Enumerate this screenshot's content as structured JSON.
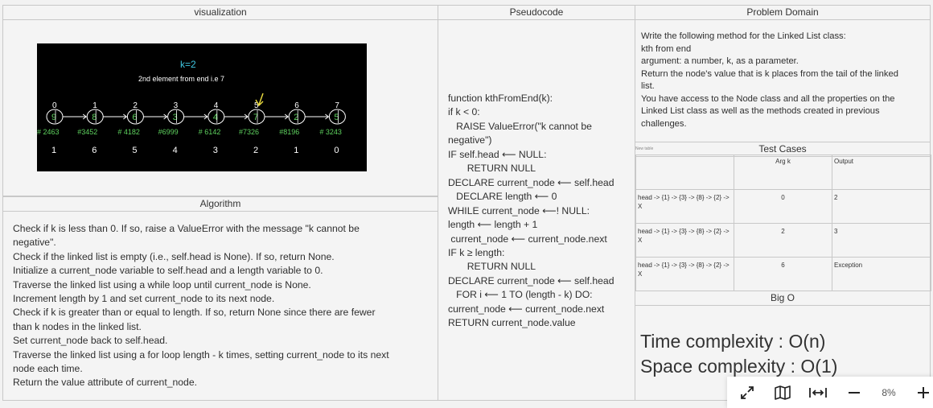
{
  "panels": {
    "visualization": {
      "title": "visualization"
    },
    "pseudocode": {
      "title": "Pseudocode",
      "lines": [
        "function kthFromEnd(k):",
        "if k < 0:",
        "   RAISE ValueError(\"k cannot be",
        "negative\")",
        "IF self.head ⟵ NULL:",
        "       RETURN NULL",
        "DECLARE current_node ⟵ self.head",
        "   DECLARE length ⟵ 0",
        "WHILE current_node ⟵! NULL:",
        "length ⟵ length + 1",
        " current_node ⟵ current_node.next",
        "IF k ≥ length:",
        "       RETURN NULL",
        "DECLARE current_node ⟵ self.head",
        "   FOR i ⟵ 1 TO (length - k) DO:",
        "current_node ⟵ current_node.next",
        "RETURN current_node.value"
      ]
    },
    "problem_domain": {
      "title": "Problem Domain",
      "lines": [
        "Write the following method for the Linked List class:",
        "kth from end",
        "argument: a number, k, as a parameter.",
        "Return the node's value that is k places from the tail of the linked",
        "list.",
        "You have access to the Node class and all the properties on the",
        "Linked List class as well as the methods created in previous",
        "challenges."
      ]
    },
    "algorithm": {
      "title": "Algorithm",
      "lines": [
        "Check if k is less than 0. If so, raise a ValueError with the message \"k cannot be",
        "negative\".",
        "Check if the linked list is empty (i.e., self.head is None). If so, return None.",
        "Initialize a current_node variable to self.head and a length variable to 0.",
        "Traverse the linked list using a while loop until current_node is None.",
        "Increment length by 1 and set current_node to its next node.",
        "Check if k is greater than or equal to length. If so, return None since there are fewer",
        "than k nodes in the linked list.",
        "Set current_node back to self.head.",
        "Traverse the linked list using a for loop length - k times, setting current_node to its next",
        "node each time.",
        "Return the value attribute of current_node."
      ]
    },
    "test_cases": {
      "title": "Test Cases",
      "table_label": "New table",
      "headers": [
        "",
        "Arg k",
        "Output"
      ],
      "rows": [
        [
          "head -> {1} -> {3} -> {8} -> {2} -> X",
          "0",
          "2"
        ],
        [
          "head -> {1} -> {3} -> {8} -> {2} -> X",
          "2",
          "3"
        ],
        [
          "head -> {1} -> {3} -> {8} -> {2} -> X",
          "6",
          "Exception"
        ]
      ]
    },
    "big_o": {
      "title": "Big O",
      "time": "Time complexity : O(n)",
      "space": "Space complexity : O(1)"
    }
  },
  "visualization_image": {
    "heading": "k=2",
    "subheading": "2nd element from end i.e 7",
    "nodes": [
      {
        "index": "0",
        "value": "9",
        "address": "# 2463",
        "from_end": "1"
      },
      {
        "index": "1",
        "value": "8",
        "address": "#3452",
        "from_end": "6"
      },
      {
        "index": "2",
        "value": "6",
        "address": "# 4182",
        "from_end": "5"
      },
      {
        "index": "3",
        "value": "3",
        "address": "#6999",
        "from_end": "4"
      },
      {
        "index": "4",
        "value": "4",
        "address": "# 6142",
        "from_end": "3"
      },
      {
        "index": "5",
        "value": "7",
        "address": "#7326",
        "from_end": "2"
      },
      {
        "index": "6",
        "value": "2",
        "address": "#8196",
        "from_end": "1"
      },
      {
        "index": "7",
        "value": "5",
        "address": "# 3243",
        "from_end": "0"
      }
    ]
  },
  "toolbar": {
    "zoom": "8%",
    "icons": [
      "fullscreen-icon",
      "map-icon",
      "fit-width-icon",
      "zoom-out-icon",
      "zoom-in-icon"
    ]
  },
  "colors": {
    "heading_cyan": "#3fc6e0",
    "node_green": "#5fd35f",
    "arrow_yellow": "#f0e040"
  }
}
